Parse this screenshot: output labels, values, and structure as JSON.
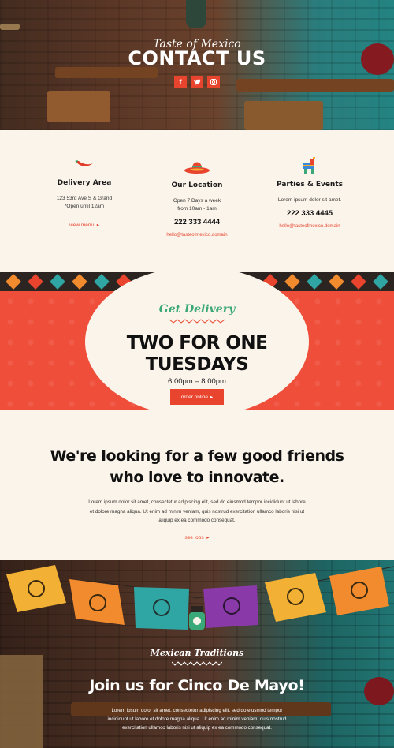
{
  "hero": {
    "script": "Taste of Mexico",
    "title": "CONTACT US",
    "socials": [
      {
        "icon": "facebook-icon",
        "glyph": "f"
      },
      {
        "icon": "twitter-icon",
        "glyph": "t"
      },
      {
        "icon": "instagram-icon",
        "glyph": "◎"
      }
    ]
  },
  "info": {
    "delivery": {
      "title": "Delivery Area",
      "line1": "123 53rd Ave S & Grand",
      "line2": "*Open until 12am",
      "link": "view menu"
    },
    "location": {
      "title": "Our Location",
      "line1": "Open 7 Days a week",
      "line2": "from 10am - 1am",
      "phone": "222 333 4444",
      "email": "hello@tasteofmexico.domain"
    },
    "parties": {
      "title": "Parties & Events",
      "line1": "Lorem ipsum dolor sit amet.",
      "phone": "222 333 4445",
      "email": "hello@tasteofmexico.domain"
    }
  },
  "promo": {
    "script": "Get Delivery",
    "title_line1": "TWO FOR ONE",
    "title_line2": "TUESDAYS",
    "time": "6:00pm  –  8:00pm",
    "button": "order online"
  },
  "jobs": {
    "title_line1": "We're looking for a few good friends",
    "title_line2": "who love to innovate.",
    "text": "Lorem ipsum dolor sit amet, consectetur adipiscing elit, sed do eiusmod tempor incididunt ut labore et dolore magna aliqua. Ut enim ad minim veniam, quis nostrud exercitation ullamco laboris nisi ut aliquip ex ea commodo consequat.",
    "link": "see jobs"
  },
  "cinco": {
    "script": "Mexican Traditions",
    "title": "Join us for Cinco De Mayo!",
    "text": "Lorem ipsum dolor sit amet, consectetur adipiscing elit, sed do eiusmod tempor incididunt ut labore et dolore magna aliqua. Ut enim ad minim veniam, quis nostrud exercitation ullamco laboris nisi ut aliquip ex ea commodo consequat."
  },
  "colors": {
    "accent": "#e8442e",
    "green": "#3aa879",
    "cream": "#fbf4ea"
  }
}
